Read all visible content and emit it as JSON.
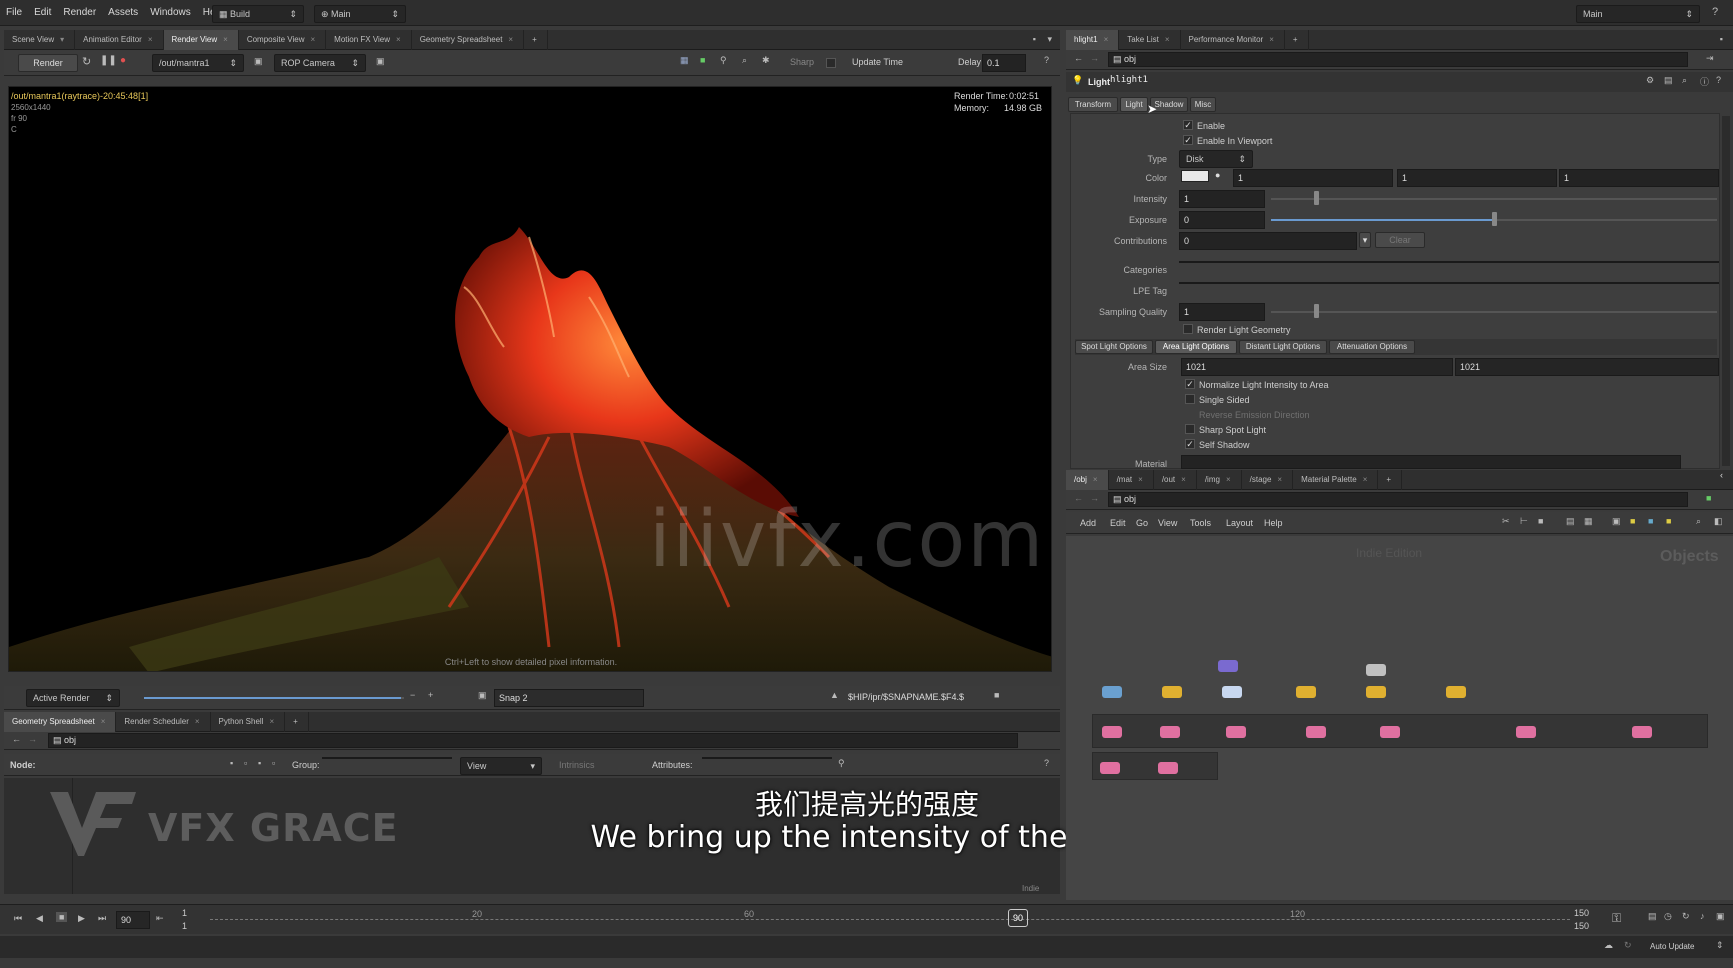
{
  "menubar": {
    "items": [
      "File",
      "Edit",
      "Render",
      "Assets",
      "Windows",
      "Help"
    ],
    "build_label": "Build",
    "main_label": "Main",
    "right_main_label": "Main"
  },
  "viewer_tabs": [
    "Scene View",
    "Animation Editor",
    "Render View",
    "Composite View",
    "Motion FX View",
    "Geometry Spreadsheet"
  ],
  "render_toolbar": {
    "render_label": "Render",
    "rop_path": "/out/mantra1",
    "camera": "ROP Camera",
    "sharp_label": "Sharp",
    "update_time_label": "Update Time",
    "delay_label": "Delay",
    "delay_value": "0.1"
  },
  "render_view": {
    "path_info": "/out/mantra1(raytrace)-20:45:48[1]",
    "resolution": "2560x1440",
    "frame": "fr 90",
    "channel": "C",
    "render_time_label": "Render Time:",
    "render_time": "0:02:51",
    "memory_label": "Memory:",
    "memory": "14.98 GB",
    "hint": "Ctrl+Left to show detailed pixel information.",
    "watermark": "iiivfx.com"
  },
  "render_bottom": {
    "active_render": "Active Render",
    "snap": "Snap 2",
    "output_path": "$HIP/ipr/$SNAPNAME.$F4.$",
    "slider_fraction": 0.99
  },
  "lower_tabs": [
    "Geometry Spreadsheet",
    "Render Scheduler",
    "Python Shell"
  ],
  "spreadsheet": {
    "path": "obj",
    "node_label": "Node:",
    "group_label": "Group:",
    "view_label": "View",
    "intrinsics_label": "Intrinsics",
    "attributes_label": "Attributes:",
    "indie_label": "Indie",
    "logo_text": "VFX GRACE"
  },
  "subtitle": {
    "chinese": "我们提高光的强度",
    "english": "We bring up the intensity of the light"
  },
  "param_tabs": [
    "hlight1",
    "Take List",
    "Performance Monitor"
  ],
  "param_path": "obj",
  "light_header": {
    "type": "Light",
    "name": "hlight1"
  },
  "light_tabs": [
    "Transform",
    "Light",
    "Shadow",
    "Misc"
  ],
  "light_params": {
    "enable": "Enable",
    "enable_viewport": "Enable In Viewport",
    "type_label": "Type",
    "type_value": "Disk",
    "color_label": "Color",
    "color_values": [
      "1",
      "1",
      "1"
    ],
    "intensity_label": "Intensity",
    "intensity_value": "1",
    "intensity_slider": 0.1,
    "exposure_label": "Exposure",
    "exposure_value": "0",
    "exposure_slider": 0.5,
    "contributions_label": "Contributions",
    "contributions_value": "0",
    "clear_label": "Clear",
    "categories_label": "Categories",
    "lpe_label": "LPE Tag",
    "sampling_label": "Sampling Quality",
    "sampling_value": "1",
    "sampling_slider": 0.1,
    "render_geo": "Render Light Geometry"
  },
  "light_subtabs": [
    "Spot Light Options",
    "Area Light Options",
    "Distant Light Options",
    "Attenuation Options"
  ],
  "area_options": {
    "area_size_label": "Area Size",
    "area_size": [
      "1021",
      "1021"
    ],
    "normalize": "Normalize Light Intensity to Area",
    "single_sided": "Single Sided",
    "reverse": "Reverse Emission Direction",
    "sharp_spot": "Sharp Spot Light",
    "self_shadow": "Self Shadow",
    "material_label": "Material"
  },
  "network_tabs": [
    "/obj",
    "/mat",
    "/out",
    "/img",
    "/stage",
    "Material Palette"
  ],
  "network_path": "obj",
  "network_menu": [
    "Add",
    "Edit",
    "Go",
    "View",
    "Tools",
    "Layout",
    "Help"
  ],
  "network": {
    "indie_edition": "Indie Edition",
    "objects_label": "Objects"
  },
  "timeline": {
    "frame": "90",
    "start": "1",
    "start2": "1",
    "ticks": [
      "20",
      "60",
      "120"
    ],
    "current": "90",
    "end": "150",
    "end2": "150",
    "auto_update": "Auto Update"
  }
}
